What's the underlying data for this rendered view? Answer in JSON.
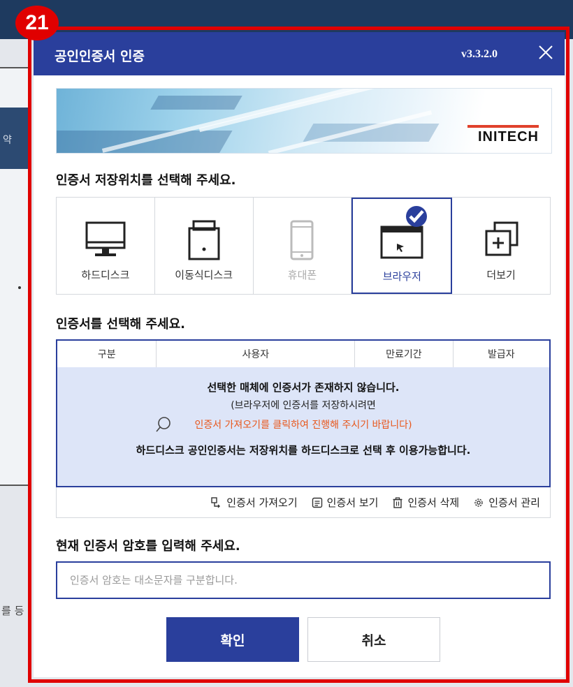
{
  "badge": "21",
  "background": {
    "left_text": "약",
    "bottom_text": "를 등"
  },
  "dialog": {
    "title": "공인인증서 인증",
    "version": "v3.3.2.0",
    "close_icon": "close-icon",
    "banner_brand": "INITECH"
  },
  "storage": {
    "label": "인증서 저장위치를 선택해 주세요.",
    "options": [
      {
        "label": "하드디스크",
        "icon": "monitor-icon",
        "state": "normal"
      },
      {
        "label": "이동식디스크",
        "icon": "usb-icon",
        "state": "normal"
      },
      {
        "label": "휴대폰",
        "icon": "phone-icon",
        "state": "disabled"
      },
      {
        "label": "브라우저",
        "icon": "browser-icon",
        "state": "selected"
      },
      {
        "label": "더보기",
        "icon": "more-icon",
        "state": "normal"
      }
    ]
  },
  "certificates": {
    "label": "인증서를 선택해 주세요.",
    "columns": [
      "구분",
      "사용자",
      "만료기간",
      "발급자"
    ],
    "empty_message_1": "선택한 매체에 인증서가 존재하지 않습니다.",
    "empty_message_2": "(브라우저에 인증서를 저장하시려면",
    "empty_message_3": "인증서 가져오기를 클릭하여 진행해 주시기 바랍니다)",
    "empty_message_4": "하드디스크 공인인증서는 저장위치를 하드디스크로 선택 후 이용가능합니다.",
    "actions": [
      {
        "label": "인증서 가져오기",
        "icon": "import-icon"
      },
      {
        "label": "인증서 보기",
        "icon": "view-icon"
      },
      {
        "label": "인증서 삭제",
        "icon": "trash-icon"
      },
      {
        "label": "인증서 관리",
        "icon": "gear-icon"
      }
    ]
  },
  "password": {
    "label": "현재 인증서 암호를 입력해 주세요.",
    "placeholder": "인증서 암호는 대소문자를 구분합니다."
  },
  "buttons": {
    "ok": "확인",
    "cancel": "취소"
  },
  "colors": {
    "primary": "#2a3f9c",
    "annotation": "#e00000",
    "notice": "#e8571c",
    "table_bg": "#dde5f8"
  }
}
